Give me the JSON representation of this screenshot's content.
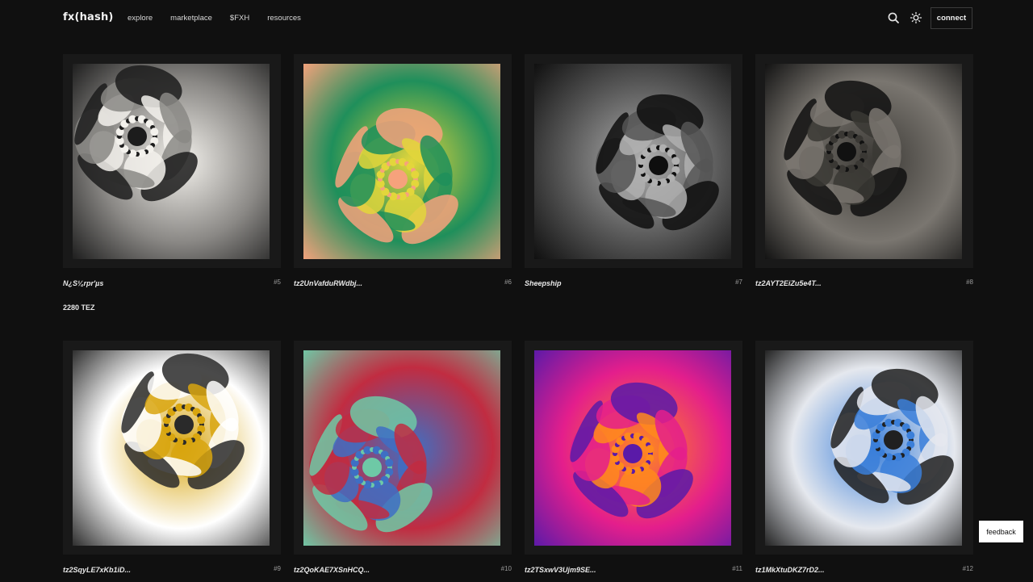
{
  "header": {
    "logo": "fx(hash)",
    "nav": [
      "explore",
      "marketplace",
      "$FXH",
      "resources"
    ],
    "search_icon": "search-icon",
    "theme_icon": "sun-icon",
    "connect_label": "connect"
  },
  "cards": [
    {
      "author": "N¿S¼rpr'µs",
      "number": "#5",
      "price": "2280 TEZ",
      "palette": [
        "#f3f1ec",
        "#8a8885",
        "#1c1c1c"
      ]
    },
    {
      "author": "tz2UnVafduRWdbj...",
      "number": "#6",
      "palette": [
        "#e3d63b",
        "#1f8f5b",
        "#f6a27c"
      ]
    },
    {
      "author": "Sheepship",
      "number": "#7",
      "palette": [
        "#b0b0b0",
        "#555555",
        "#0e0e0e"
      ]
    },
    {
      "author": "tz2AYT2EiZu5e4T...",
      "number": "#8",
      "palette": [
        "#3a3834",
        "#7a7670",
        "#111111"
      ]
    },
    {
      "author": "tz2SqyLE7xKb1iD...",
      "number": "#9",
      "palette": [
        "#d8a50e",
        "#ffffff",
        "#2a2a2a"
      ]
    },
    {
      "author": "tz2QoKAE7XSnHCQ...",
      "number": "#10",
      "palette": [
        "#3e6fc4",
        "#c12c41",
        "#6ec9a6"
      ]
    },
    {
      "author": "tz2TSxwV3Ujm9SE...",
      "number": "#11",
      "palette": [
        "#ff8a1c",
        "#e41e8c",
        "#5a1aa8"
      ]
    },
    {
      "author": "tz1MkXtuDKZ7rD2...",
      "number": "#12",
      "palette": [
        "#3b7fd9",
        "#e5e8ee",
        "#202020"
      ]
    }
  ],
  "feedback_label": "feedback"
}
